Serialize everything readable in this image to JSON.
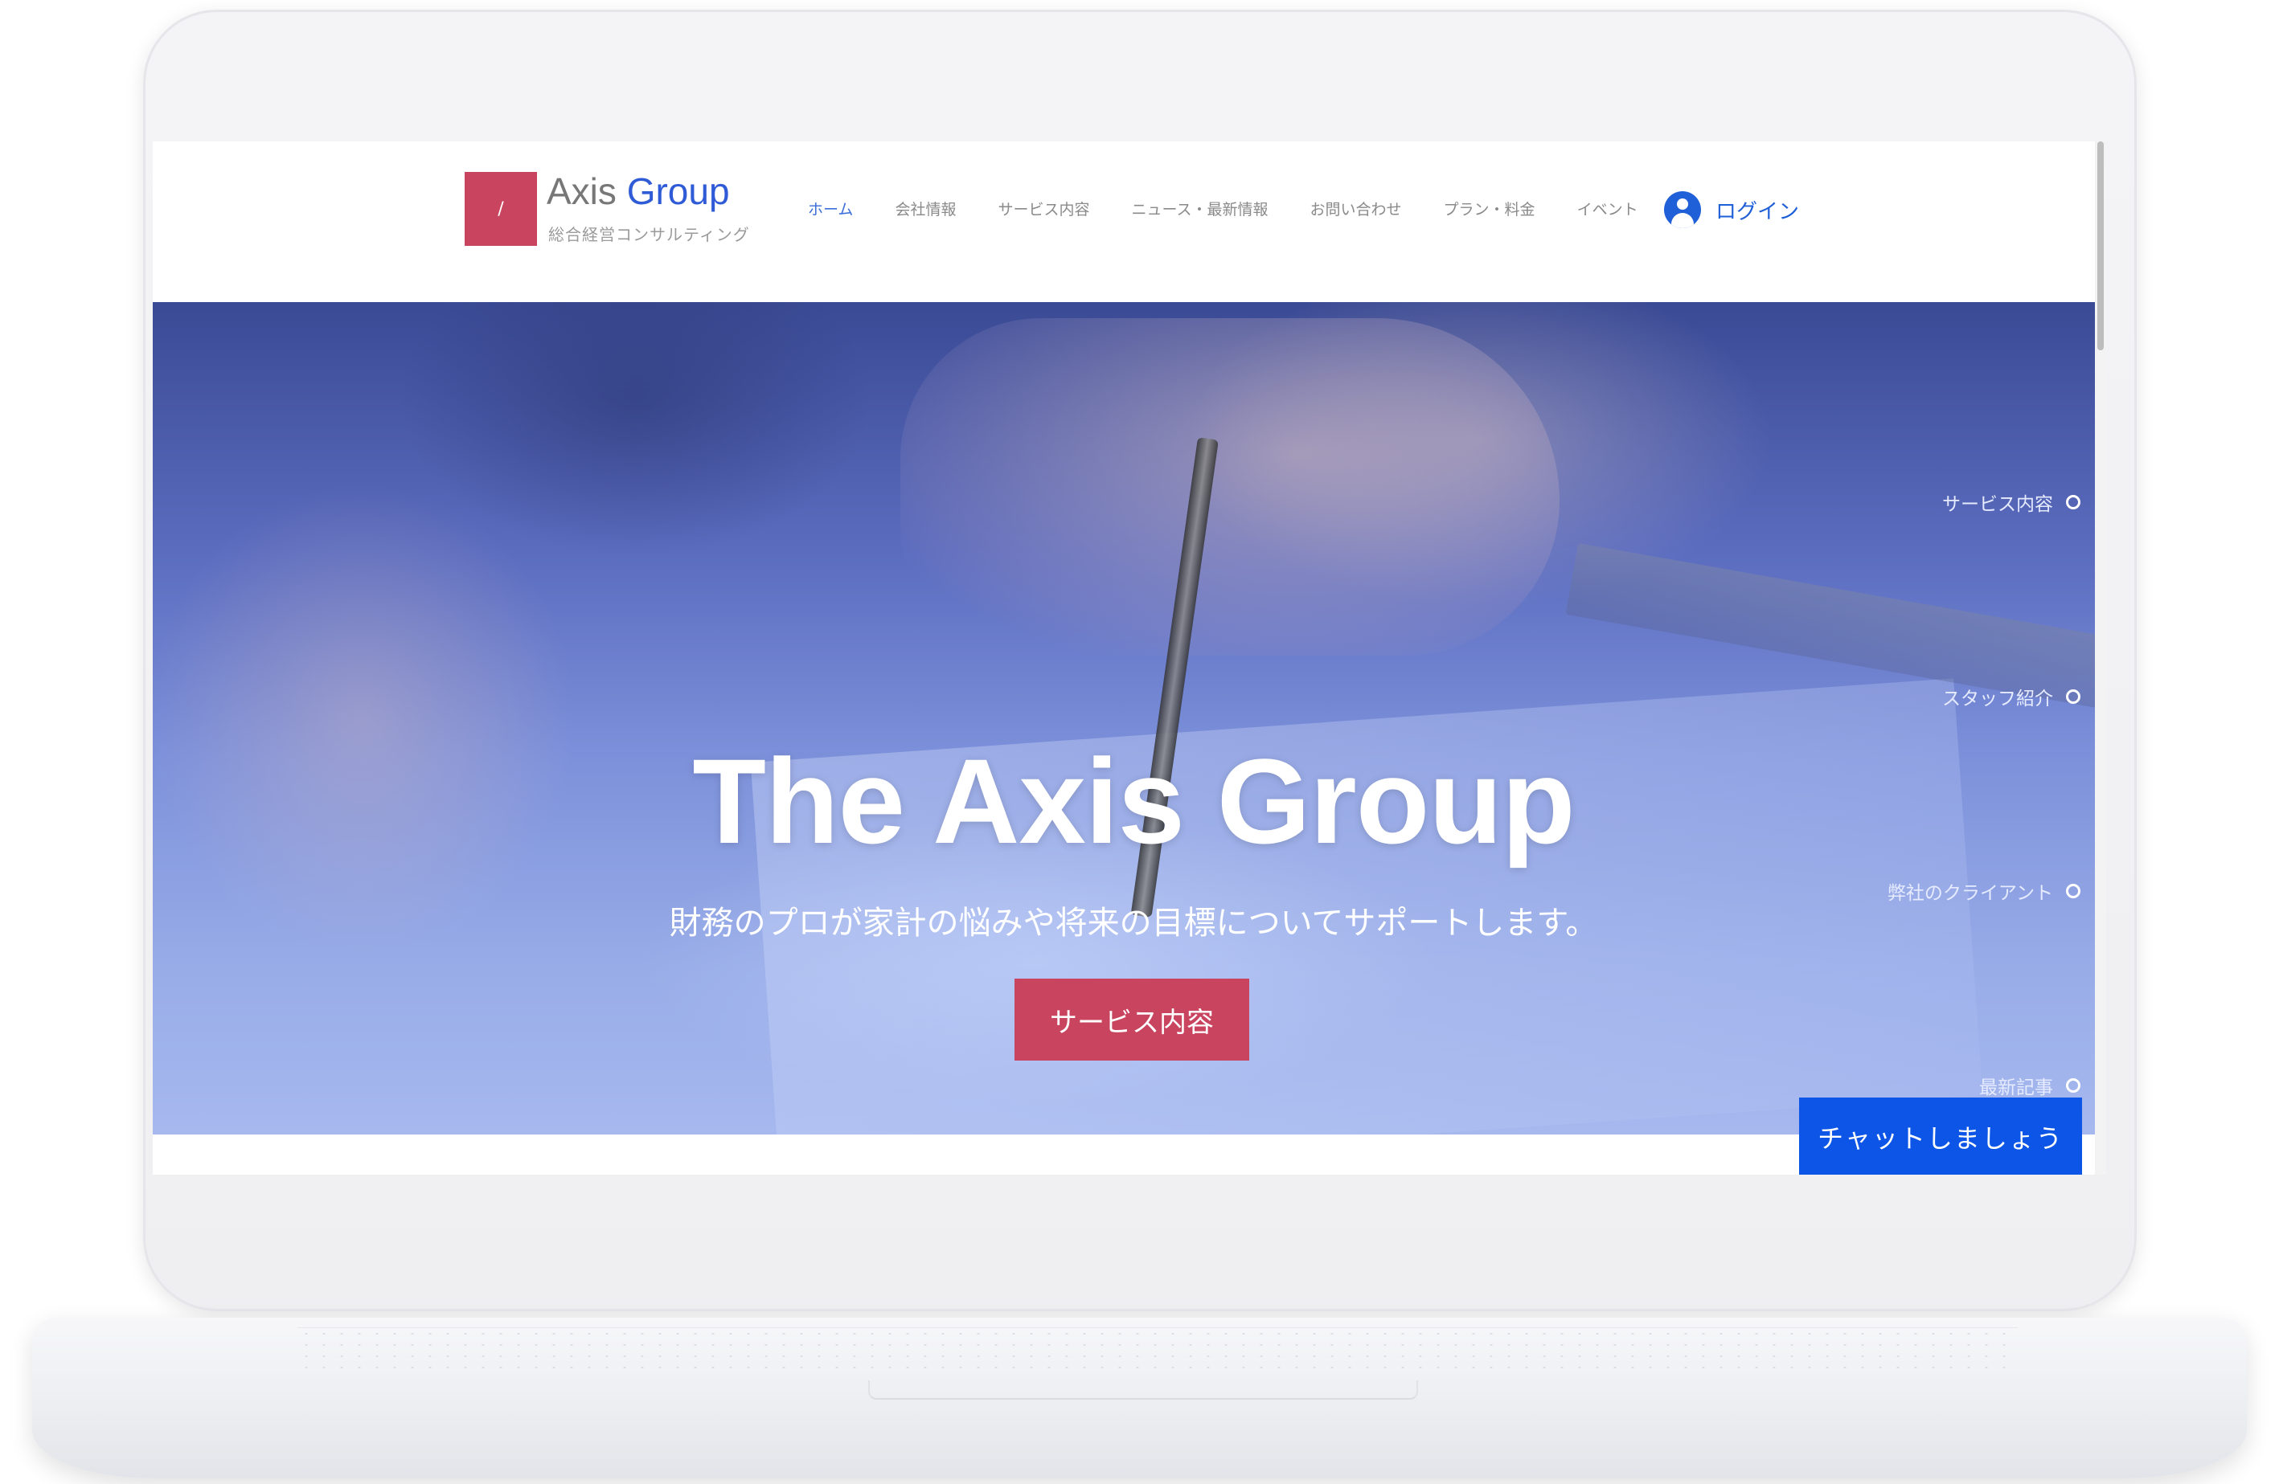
{
  "header": {
    "logo_glyph": "/",
    "brand_word1": "Axis",
    "brand_word2": "Group",
    "brand_subtitle": "総合経営コンサルティング",
    "nav": [
      {
        "label": "ホーム",
        "active": true
      },
      {
        "label": "会社情報",
        "active": false
      },
      {
        "label": "サービス内容",
        "active": false
      },
      {
        "label": "ニュース・最新情報",
        "active": false
      },
      {
        "label": "お問い合わせ",
        "active": false
      },
      {
        "label": "プラン・料金",
        "active": false
      },
      {
        "label": "イベント",
        "active": false
      }
    ],
    "login_label": "ログイン",
    "login_icon": "user-avatar-icon"
  },
  "hero": {
    "title": "The Axis Group",
    "subtitle": "財務のプロが家計の悩みや将来の目標についてサポートします。",
    "button_label": "サービス内容",
    "anchor_menu": [
      {
        "label": "サービス内容"
      },
      {
        "label": "スタッフ紹介"
      },
      {
        "label": "弊社のクライアント"
      },
      {
        "label": "最新記事"
      }
    ]
  },
  "chat": {
    "label": "チャットしましょう"
  },
  "colors": {
    "accent_pink": "#c9455f",
    "brand_blue": "#2f5bd7",
    "chat_blue": "#0d55e6",
    "nav_active": "#3b6ed8"
  }
}
